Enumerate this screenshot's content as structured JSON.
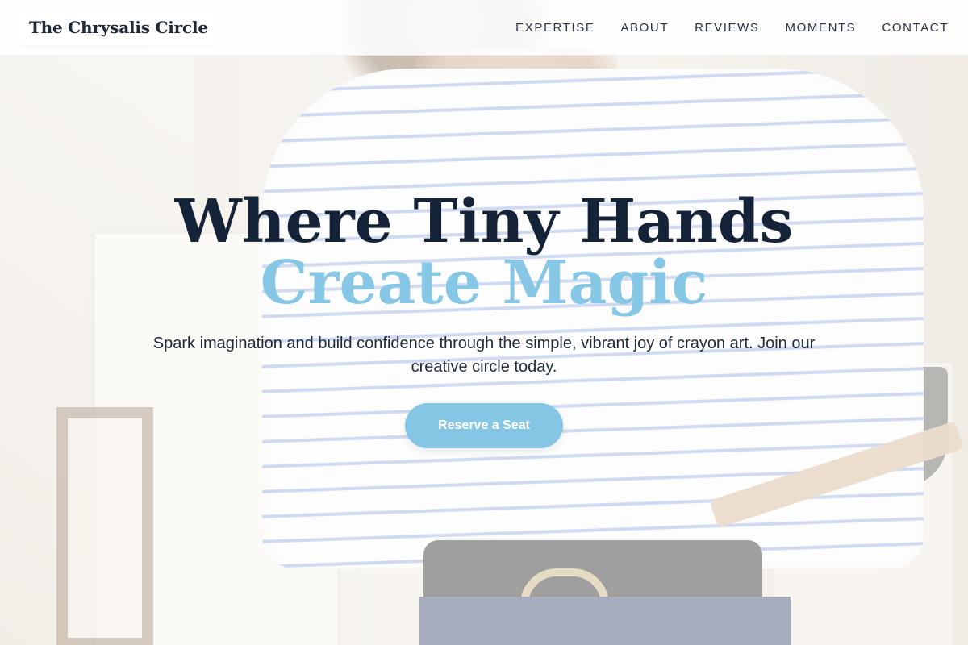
{
  "header": {
    "brand": "The Chrysalis Circle",
    "nav": [
      "EXPERTISE",
      "ABOUT",
      "REVIEWS",
      "MOMENTS",
      "CONTACT"
    ]
  },
  "hero": {
    "title_line1": "Where Tiny Hands",
    "title_line2": "Create Magic",
    "lead": "Spark imagination and build confidence through the simple, vibrant joy of crayon art. Join our creative circle today.",
    "cta_label": "Reserve a Seat"
  },
  "colors": {
    "accent": "#86c6e5",
    "heading": "#142338",
    "text": "#1d2a3a"
  }
}
